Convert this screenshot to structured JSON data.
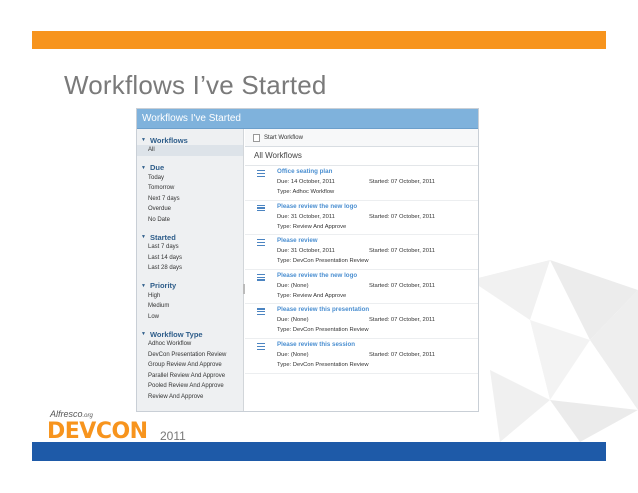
{
  "slide": {
    "title": "Workflows I’ve Started"
  },
  "app": {
    "header_title": "Workflows I've Started",
    "toolbar": {
      "start_label": "Start Workflow"
    },
    "list_title": "All Workflows"
  },
  "sidebar": {
    "groups": [
      {
        "label": "Workflows",
        "items": [
          "All"
        ]
      },
      {
        "label": "Due",
        "items": [
          "Today",
          "Tomorrow",
          "Next 7 days",
          "Overdue",
          "No Date"
        ]
      },
      {
        "label": "Started",
        "items": [
          "Last 7 days",
          "Last 14 days",
          "Last 28 days"
        ]
      },
      {
        "label": "Priority",
        "items": [
          "High",
          "Medium",
          "Low"
        ]
      },
      {
        "label": "Workflow Type",
        "items": [
          "Adhoc Workflow",
          "DevCon Presentation Review",
          "Group Review And Approve",
          "Parallel Review And Approve",
          "Pooled Review And Approve",
          "Review And Approve"
        ]
      }
    ]
  },
  "workflows": [
    {
      "title": "Office seating plan",
      "due": "Due: 14 October, 2011",
      "started": "Started: 07 October, 2011",
      "type": "Type: Adhoc Workflow"
    },
    {
      "title": "Please review the new logo",
      "due": "Due: 31 October, 2011",
      "started": "Started: 07 October, 2011",
      "type": "Type: Review And Approve"
    },
    {
      "title": "Please review",
      "due": "Due: 31 October, 2011",
      "started": "Started: 07 October, 2011",
      "type": "Type: DevCon Presentation Review"
    },
    {
      "title": "Please review the new logo",
      "due": "Due: (None)",
      "started": "Started: 07 October, 2011",
      "type": "Type: Review And Approve"
    },
    {
      "title": "Please review this presentation",
      "due": "Due: (None)",
      "started": "Started: 07 October, 2011",
      "type": "Type: DevCon Presentation Review"
    },
    {
      "title": "Please review this session",
      "due": "Due: (None)",
      "started": "Started: 07 October, 2011",
      "type": "Type: DevCon Presentation Review"
    }
  ],
  "branding": {
    "company": "Alfresco",
    "company_suffix": ".org",
    "event": "DEVCON",
    "year": "2011",
    "accent_color": "#f7941d",
    "footer_color": "#1e5aa8"
  }
}
